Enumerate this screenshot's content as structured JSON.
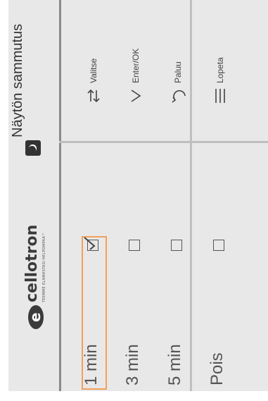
{
  "header": {
    "title": "Näytön sammutus"
  },
  "logo": {
    "brand": "cellotron",
    "tagline": "TEEMME ELAMASTASI HELPOMPAA™"
  },
  "options": [
    {
      "label": "1 min",
      "checked": true,
      "selected": true
    },
    {
      "label": "3 min",
      "checked": false,
      "selected": false
    },
    {
      "label": "5 min",
      "checked": false,
      "selected": false
    },
    {
      "label": "Pois",
      "checked": false,
      "selected": false
    }
  ],
  "help": {
    "select": "Valitse",
    "enter": "Enter/OK",
    "back": "Paluu",
    "quit": "Lopeta"
  },
  "colors": {
    "selection": "#f0a15a",
    "panel": "#e8e8e8"
  }
}
